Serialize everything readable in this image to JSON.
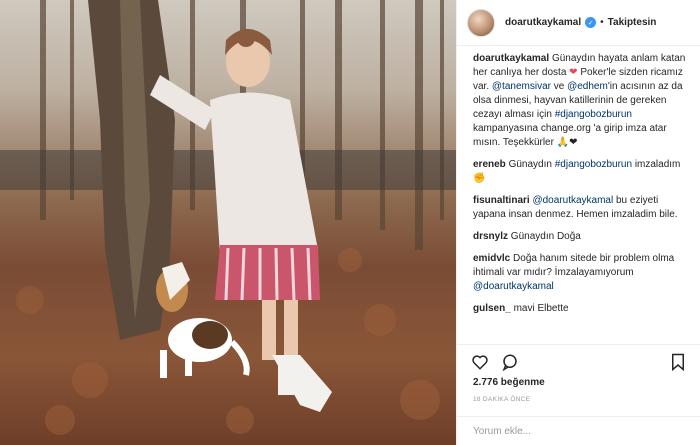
{
  "header": {
    "username": "doarutkaykamal",
    "separator": "•",
    "follow_status": "Takiptesin"
  },
  "caption": {
    "username": "doarutkaykamal",
    "t1": "Günaydın hayata anlam katan her canlıya her dosta",
    "t2": "Poker'le sizden ricamız var.",
    "m1": "@tanemsivar",
    "t3": "ve",
    "m2": "@edhem",
    "t4": "'in acısının az da olsa dinmesi, hayvan katillerinin de gereken cezayı alması için",
    "h1": "#djangobozburun",
    "t5": "kampanyasına change.org 'a girip imza atar mısın. Teşekkürler"
  },
  "comments": [
    {
      "user": "ereneb",
      "pre": "Günaydın",
      "tag": "#djangobozburun",
      "post": "imzaladım"
    },
    {
      "user": "fisunaltinari",
      "pre": "",
      "tag": "@doarutkaykamal",
      "post": "bu eziyeti yapana insan denmez. Hemen imzaladim bile."
    },
    {
      "user": "drsnylz",
      "pre": "Günaydın Doğa",
      "tag": "",
      "post": ""
    },
    {
      "user": "emidvlc",
      "pre": "Doğa hanım sitede bir problem olma ihtimali var mıdır? İmzalayamıyorum",
      "tag": "@doarutkaykamal",
      "post": ""
    },
    {
      "user": "gulsen_",
      "pre": "mavi Elbette",
      "tag": "",
      "post": ""
    }
  ],
  "likes": "2.776 beğenme",
  "timestamp": "18 DAKİKA ÖNCE",
  "comment_placeholder": "Yorum ekle...",
  "icons": [
    "heart-icon",
    "comment-icon",
    "bookmark-icon",
    "verified-badge-icon"
  ],
  "colors": {
    "link": "#003569",
    "verified": "#3897f0",
    "heart": "#ed4956"
  }
}
